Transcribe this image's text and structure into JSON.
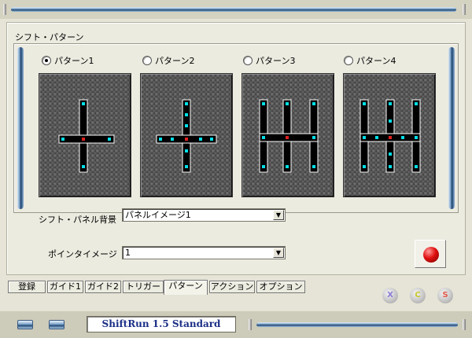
{
  "group_label": "シフト・パターン",
  "patterns": [
    {
      "label": "パターン1",
      "selected": true
    },
    {
      "label": "パターン2",
      "selected": false
    },
    {
      "label": "パターン3",
      "selected": false
    },
    {
      "label": "パターン4",
      "selected": false
    }
  ],
  "background_label": "シフト・パネル背景",
  "background_value": "パネルイメージ1",
  "pointer_label": "ポインタイメージ",
  "pointer_value": "1",
  "tabs": [
    "登録",
    "ガイド1",
    "ガイド2",
    "トリガー",
    "パターン",
    "アクション",
    "オプション"
  ],
  "active_tab": "パターン",
  "circle_buttons": [
    {
      "letter": "X",
      "color": "#8c7ad6"
    },
    {
      "letter": "C",
      "color": "#c8c828"
    },
    {
      "letter": "S",
      "color": "#e05a4a"
    }
  ],
  "app_title": "ShiftRun 1.5 Standard",
  "colors": {
    "accent": "#1a2e86",
    "gate_dot": "#00e0e8",
    "neutral_dot": "#e02020"
  }
}
